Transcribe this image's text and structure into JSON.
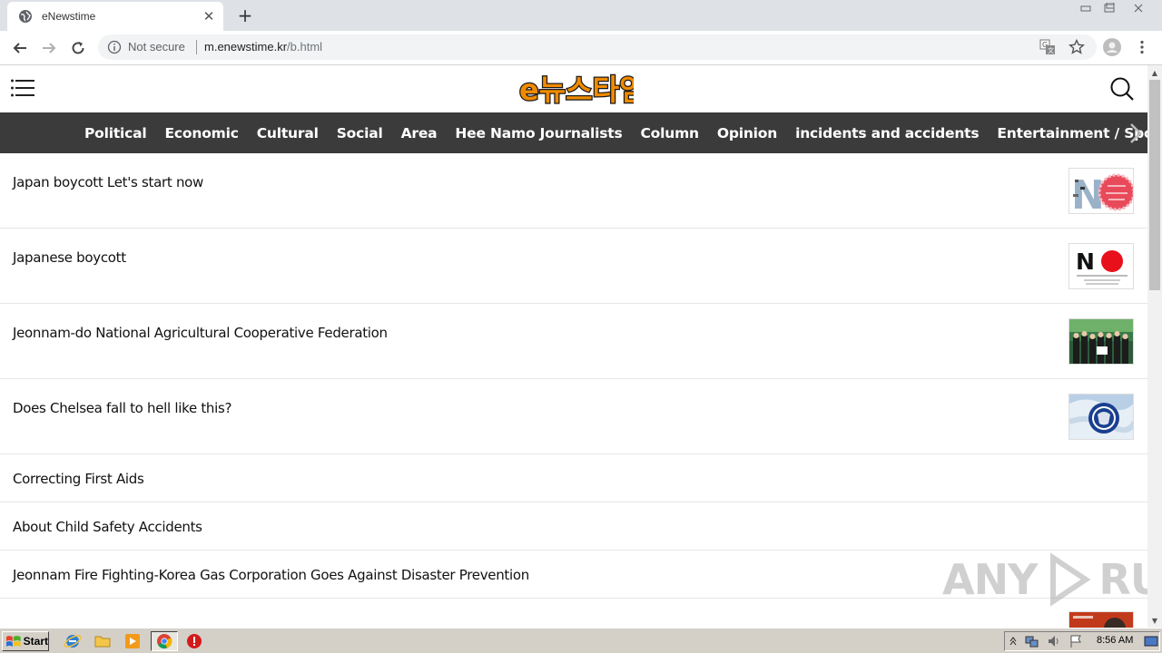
{
  "browser": {
    "tab_title": "eNewstime",
    "new_tab_label": "+",
    "security_label": "Not secure",
    "url_host": "m.enewstime.kr",
    "url_path": "/b.html"
  },
  "site": {
    "logo_text": "e뉴스타임",
    "categories": [
      "Political",
      "Economic",
      "Cultural",
      "Social",
      "Area",
      "Hee Namo Journalists",
      "Column",
      "Opinion",
      "incidents and accidents",
      "Entertainment / Sports"
    ]
  },
  "articles": [
    {
      "title": "Japan boycott Let's start now",
      "thumb": "no-boycott-collage"
    },
    {
      "title": "Japanese boycott",
      "thumb": "no-boycott-logo"
    },
    {
      "title": "Jeonnam-do National Agricultural Cooperative Federation",
      "thumb": "group-photo"
    },
    {
      "title": "Does Chelsea fall to hell like this?",
      "thumb": "chelsea-flag"
    },
    {
      "title": "Correcting First Aids"
    },
    {
      "title": "About Child Safety Accidents"
    },
    {
      "title": "Jeonnam Fire Fighting-Korea Gas Corporation Goes Against Disaster Prevention"
    }
  ],
  "watermark": "ANY RUN",
  "taskbar": {
    "start_label": "Start",
    "clock": "8:56 AM"
  },
  "colors": {
    "nav_bg": "#3b3b3b",
    "logo_orange": "#f08a00"
  }
}
